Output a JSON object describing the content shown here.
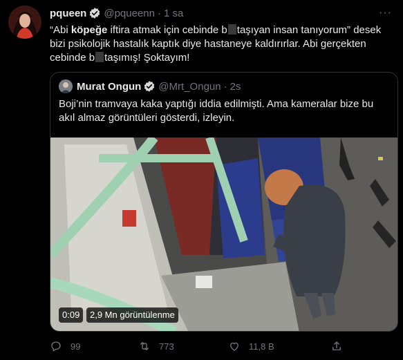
{
  "tweet": {
    "name": "pqueen",
    "handle": "@pqueenn",
    "dot": "·",
    "time": "1 sa",
    "more": "···",
    "text_parts": {
      "p1": "“Abi ",
      "p2": "köpeğe",
      "p3": " iftira atmak için cebinde b",
      "p4": "taşıyan insan tanıyorum” desek bizi psikolojik hastalık kaptık diye hastaneye kaldırırlar. Abi gerçekten cebinde b",
      "p5": "taşımış! Şoktayım!"
    }
  },
  "quote": {
    "name": "Murat Ongun",
    "handle": "@Mrt_Ongun",
    "dot": "·",
    "time": "2s",
    "text": "Boji’nin tramvaya kaka yaptığı iddia edilmişti. Ama kameralar bize bu akıl almaz görüntüleri gösterdi, izleyin.",
    "video": {
      "duration": "0:09",
      "views": "2,9 Mn görüntülenme"
    }
  },
  "actions": {
    "reply_count": "99",
    "retweet_count": "773",
    "like_count": "11,8 B"
  },
  "colors": {
    "background": "#000000",
    "text": "#e7e9ea",
    "muted": "#71767b",
    "verified": "#1d9bf0",
    "border": "#2f3336"
  },
  "icons": [
    "verified-badge-icon",
    "more-icon",
    "reply-icon",
    "retweet-icon",
    "like-icon",
    "share-icon"
  ]
}
